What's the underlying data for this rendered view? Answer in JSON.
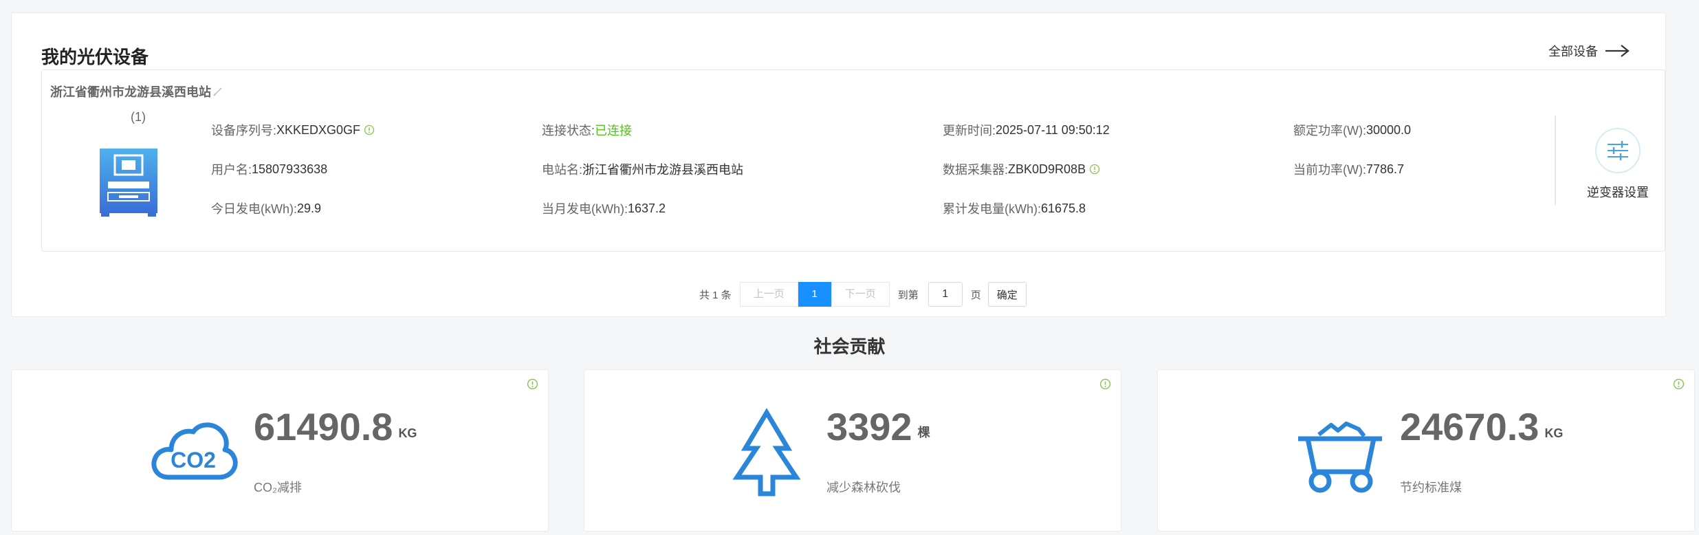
{
  "panel": {
    "title": "我的光伏设备",
    "all_devices_label": "全部设备"
  },
  "station": {
    "name": "浙江省衢州市龙游县溪西电站",
    "index": "(1)",
    "fields": {
      "serial": {
        "label": "设备序列号:",
        "value": "XKKEDXG0GF"
      },
      "connection": {
        "label": "连接状态:",
        "value": "已连接"
      },
      "update_time": {
        "label": "更新时间:",
        "value": "2025-07-11 09:50:12"
      },
      "rated_power": {
        "label": "额定功率(W):",
        "value": "30000.0"
      },
      "username": {
        "label": "用户名:",
        "value": "15807933638"
      },
      "station_name": {
        "label": "电站名:",
        "value": "浙江省衢州市龙游县溪西电站"
      },
      "collector": {
        "label": "数据采集器:",
        "value": "ZBK0D9R08B"
      },
      "current_power": {
        "label": "当前功率(W):",
        "value": "7786.7"
      },
      "today_gen": {
        "label": "今日发电(kWh):",
        "value": "29.9"
      },
      "month_gen": {
        "label": "当月发电(kWh):",
        "value": "1637.2"
      },
      "total_gen": {
        "label": "累计发电量(kWh):",
        "value": "61675.8"
      }
    },
    "inverter_settings_label": "逆变器设置"
  },
  "pager": {
    "total": "共 1 条",
    "prev": "上一页",
    "current": "1",
    "next": "下一页",
    "goto": "到第",
    "page_input": "1",
    "page_unit": "页",
    "confirm": "确定"
  },
  "contribution": {
    "title": "社会贡献",
    "cards": [
      {
        "value": "61490.8",
        "unit": "KG",
        "label": "CO₂减排",
        "icon": "co2-cloud-icon"
      },
      {
        "value": "3392",
        "unit": "棵",
        "label": "减少森林砍伐",
        "icon": "tree-icon"
      },
      {
        "value": "24670.3",
        "unit": "KG",
        "label": "节约标准煤",
        "icon": "coal-cart-icon"
      }
    ]
  },
  "colors": {
    "primary": "#1890ff",
    "icon_blue": "#2b86d9",
    "connected_green": "#52c41a",
    "tip_green": "#8bc34a"
  }
}
